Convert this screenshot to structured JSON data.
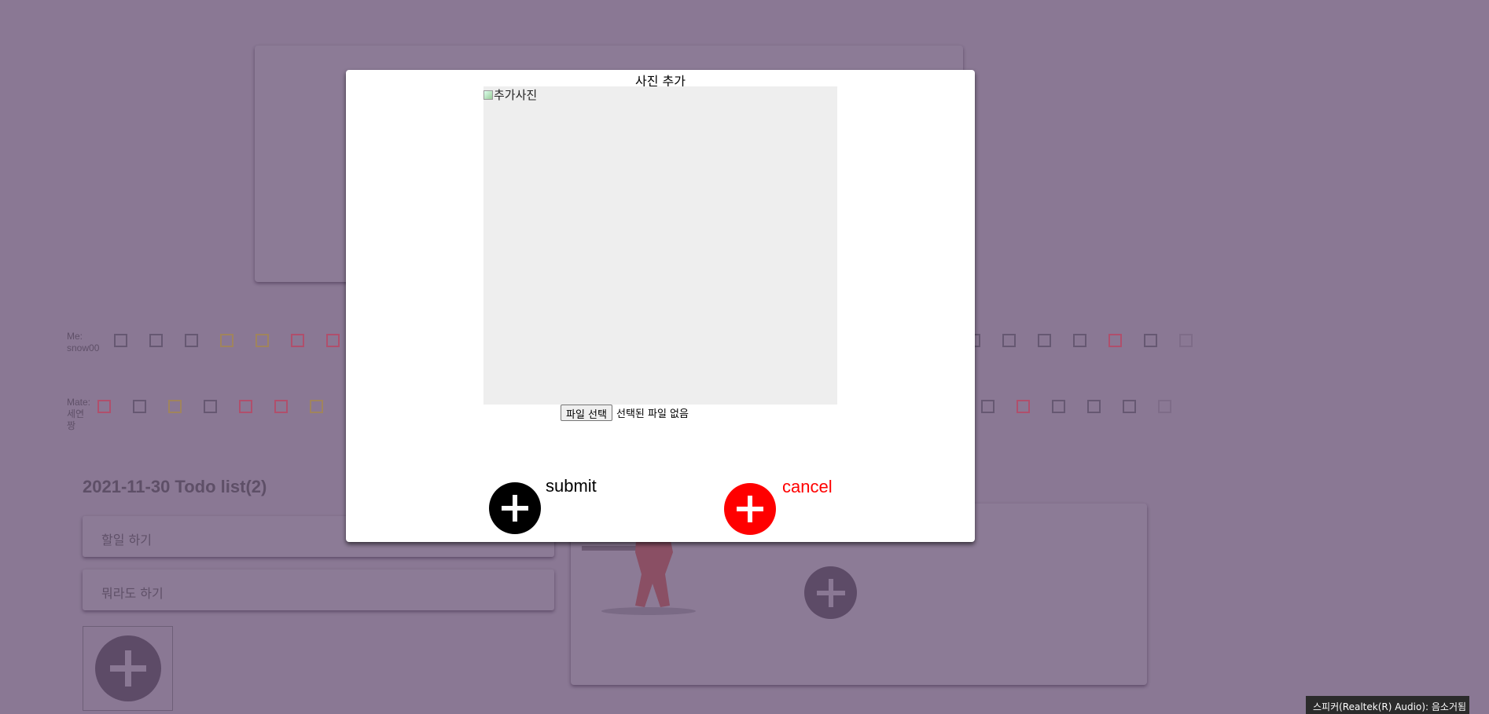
{
  "background": {
    "me_label": "Me:\nsnow00",
    "mate_label": "Mate:\n세연\n짱",
    "todo_title": "2021-11-30 Todo list(2)",
    "todo_items": [
      "할일 하기",
      "뭐라도 하기"
    ],
    "colors": {
      "overlay": "#8a7894",
      "check_red": "#b04f6c",
      "check_yellow": "#a0845d"
    }
  },
  "modal": {
    "title": "사진 추가",
    "image_alt": "추가사진",
    "file_button": "파일 선택",
    "file_status": "선택된 파일 없음",
    "submit_label": "submit",
    "cancel_label": "cancel",
    "icons": {
      "submit": "plus-circle-icon",
      "cancel": "plus-circle-icon"
    },
    "colors": {
      "submit": "#000000",
      "cancel": "#ff0000"
    }
  },
  "tooltip": {
    "text": "스피커(Realtek(R) Audio): 음소거됨"
  }
}
